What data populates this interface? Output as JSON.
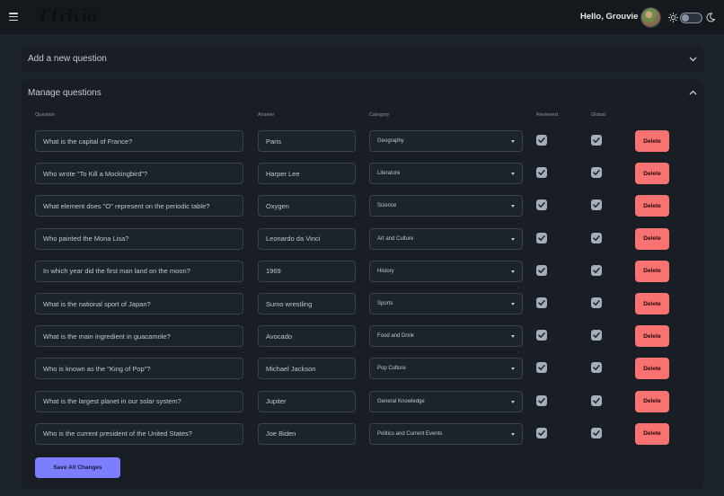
{
  "navbar": {
    "logo": "TTrivia",
    "greeting": "Hello, Grouvie"
  },
  "add_panel": {
    "title": "Add a new question"
  },
  "manage_panel": {
    "title": "Manage questions",
    "headers": {
      "question": "Question",
      "answer": "Answer",
      "category": "Category",
      "reviewed": "Reviewed",
      "global": "Global"
    },
    "delete_label": "Delete",
    "save_label": "Save All Changes",
    "rows": [
      {
        "question": "What is the capital of France?",
        "answer": "Paris",
        "category": "Geography",
        "reviewed": true,
        "global": true
      },
      {
        "question": "Who wrote \"To Kill a Mockingbird\"?",
        "answer": "Harper Lee",
        "category": "Literature",
        "reviewed": true,
        "global": true
      },
      {
        "question": "What element does \"O\" represent on the periodic table?",
        "answer": "Oxygen",
        "category": "Science",
        "reviewed": true,
        "global": true
      },
      {
        "question": "Who painted the Mona Lisa?",
        "answer": "Leonardo da Vinci",
        "category": "Art and Culture",
        "reviewed": true,
        "global": true
      },
      {
        "question": "In which year did the first man land on the moon?",
        "answer": "1969",
        "category": "History",
        "reviewed": true,
        "global": true
      },
      {
        "question": "What is the national sport of Japan?",
        "answer": "Sumo wrestling",
        "category": "Sports",
        "reviewed": true,
        "global": true
      },
      {
        "question": "What is the main ingredient in guacamole?",
        "answer": "Avocado",
        "category": "Food and Drink",
        "reviewed": true,
        "global": true
      },
      {
        "question": "Who is known as the \"King of Pop\"?",
        "answer": "Michael Jackson",
        "category": "Pop Culture",
        "reviewed": true,
        "global": true
      },
      {
        "question": "What is the largest planet in our solar system?",
        "answer": "Jupiter",
        "category": "General Knowledge",
        "reviewed": true,
        "global": true
      },
      {
        "question": "Who is the current president of the United States?",
        "answer": "Joe Biden",
        "category": "Politics and Current Events",
        "reviewed": true,
        "global": true
      }
    ]
  },
  "colors": {
    "background": "#1d232a",
    "panel": "#191e24",
    "delete": "#f87272",
    "primary": "#7c7eff"
  },
  "icons": {
    "menu": "hamburger-icon",
    "theme_light": "sun-icon",
    "theme_dark": "moon-icon",
    "collapse": "chevron-icon",
    "select": "caret-down-icon",
    "checkbox": "check-icon"
  }
}
